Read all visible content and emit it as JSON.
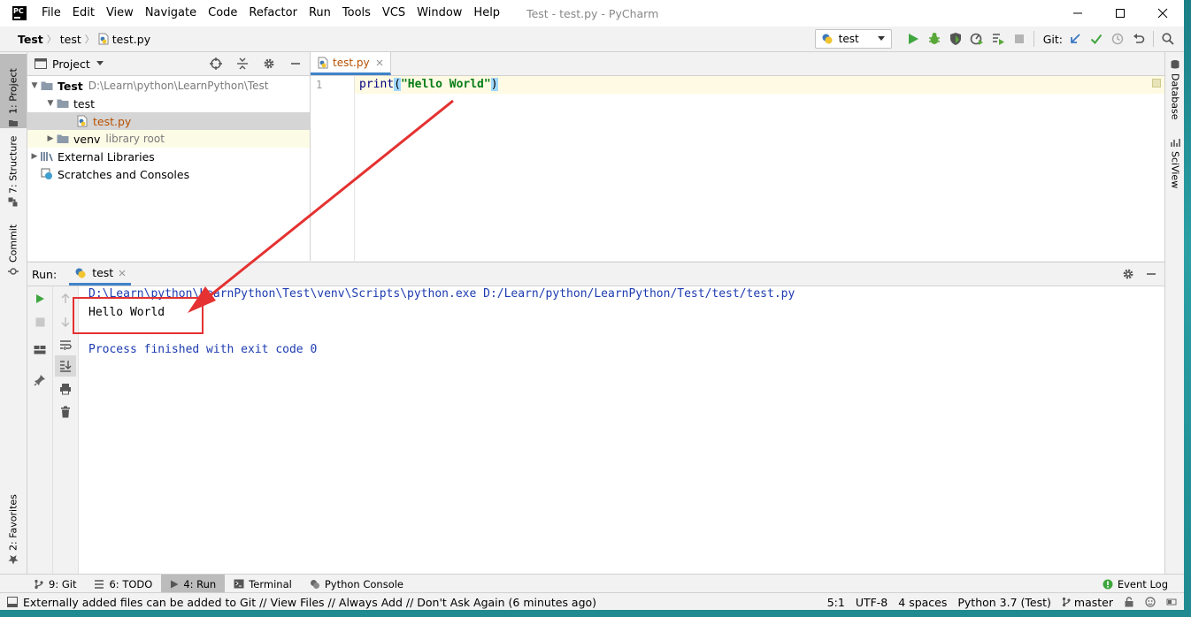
{
  "window": {
    "title": "Test - test.py - PyCharm",
    "menu": [
      {
        "id": "file",
        "label": "File"
      },
      {
        "id": "edit",
        "label": "Edit"
      },
      {
        "id": "view",
        "label": "View"
      },
      {
        "id": "navigate",
        "label": "Navigate"
      },
      {
        "id": "code",
        "label": "Code"
      },
      {
        "id": "refactor",
        "label": "Refactor"
      },
      {
        "id": "run",
        "label": "Run"
      },
      {
        "id": "tools",
        "label": "Tools"
      },
      {
        "id": "vcs",
        "label": "VCS"
      },
      {
        "id": "window",
        "label": "Window"
      },
      {
        "id": "help",
        "label": "Help"
      }
    ]
  },
  "navbar": {
    "breadcrumbs": [
      "Test",
      "test",
      "test.py"
    ],
    "run_config": "test",
    "git_label": "Git:"
  },
  "left_stripe": {
    "project": "1: Project",
    "structure": "7: Structure",
    "commit": "Commit",
    "favorites": "2: Favorites"
  },
  "right_stripe": {
    "database": "Database",
    "sciview": "SciView"
  },
  "project_panel": {
    "title": "Project",
    "tree": {
      "root_name": "Test",
      "root_path": "D:\\Learn\\python\\LearnPython\\Test",
      "folder_test": "test",
      "file_test_py": "test.py",
      "venv": "venv",
      "venv_note": "library root",
      "external_libs": "External Libraries",
      "scratches": "Scratches and Consoles"
    }
  },
  "editor": {
    "tab_label": "test.py",
    "line_number": "1",
    "code": {
      "fn": "print",
      "open_paren": "(",
      "string": "\"Hello World\"",
      "close_paren": ")"
    }
  },
  "run_panel": {
    "label": "Run:",
    "tab_label": "test",
    "console": {
      "command": "D:\\Learn\\python\\LearnPython\\Test\\venv\\Scripts\\python.exe D:/Learn/python/LearnPython/Test/test/test.py",
      "output": "Hello World",
      "finished": "Process finished with exit code 0"
    }
  },
  "bottom_tabs": {
    "git": "9: Git",
    "todo": "6: TODO",
    "run": "4: Run",
    "terminal": "Terminal",
    "python_console": "Python Console",
    "event_log": "Event Log"
  },
  "status": {
    "message": "Externally added files can be added to Git // View Files // Always Add // Don't Ask Again (6 minutes ago)",
    "position": "5:1",
    "encoding": "UTF-8",
    "indent": "4 spaces",
    "interpreter": "Python 3.7 (Test)",
    "branch": "master"
  },
  "colors": {
    "run_green": "#3fa63f",
    "accent_blue": "#4083c9",
    "annotation_red": "#e53131"
  }
}
